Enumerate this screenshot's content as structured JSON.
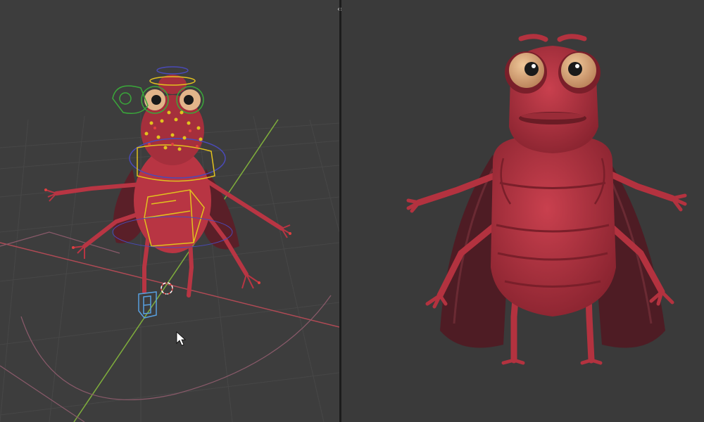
{
  "app": {
    "split_handle_glyph": "‹›"
  },
  "icons": {
    "split": "split-arrows-icon",
    "cursor": "mouse-pointer-icon",
    "origin": "3d-cursor-icon",
    "empty": "bone-shape-icon"
  },
  "colors": {
    "viewport_bg": "#3d3d3d",
    "render_bg": "#3a3a3a",
    "grid": "#4a4a4a",
    "x_axis": "#b04a55",
    "y_axis": "#7fae3c",
    "body_red": "#b83543",
    "body_dark": "#7a1f2a",
    "wing": "#5a1f28",
    "eye_white": "#e2b58a",
    "pupil": "#1a1a1a",
    "rig_yellow": "#e2c21e",
    "rig_green": "#3aa83a",
    "rig_blue": "#4a4ab8",
    "rig_red": "#e04040",
    "empty_blue": "#58a0e0"
  }
}
